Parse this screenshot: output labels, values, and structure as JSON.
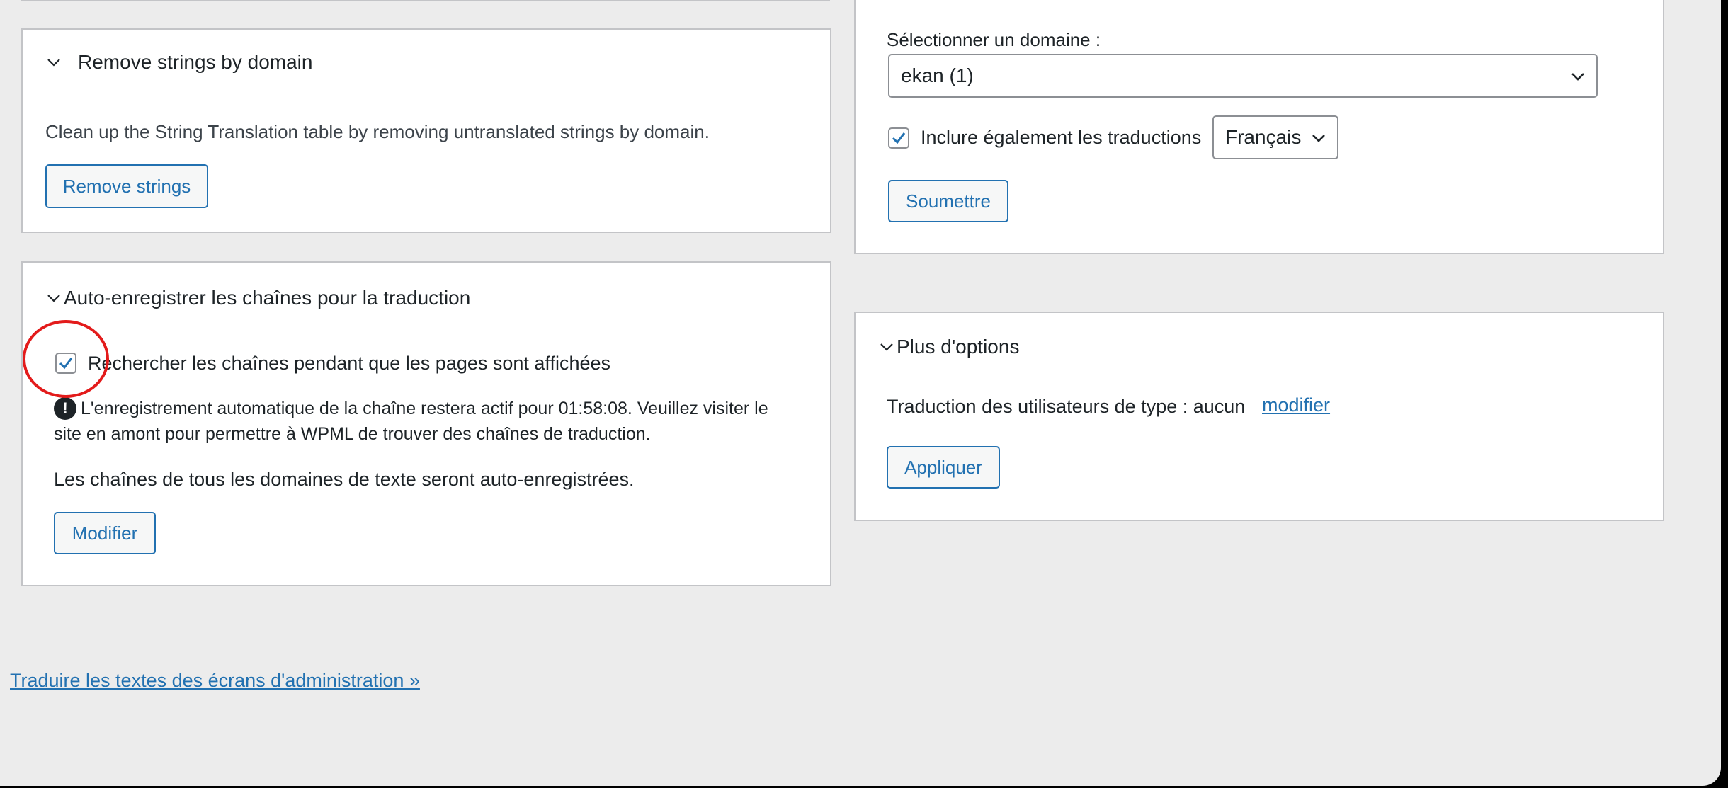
{
  "left_top_box": {
    "title": "Remove strings by domain",
    "description": "Clean up the String Translation table by removing untranslated strings by domain.",
    "button_label": "Remove strings"
  },
  "right_top_box": {
    "select_label": "Sélectionner un domaine :",
    "select_value": "ekan (1)",
    "include_translations_label": "Inclure également les traductions",
    "include_translations_checked": true,
    "language_value": "Français",
    "submit_label": "Soumettre"
  },
  "auto_register_box": {
    "title": "Auto-enregistrer les chaînes pour la traduction",
    "checkbox_label": "Rechercher les chaînes pendant que les pages sont affichées",
    "checkbox_checked": true,
    "notice_line1": "L'enregistrement automatique de la chaîne restera actif pour 01:58:08. Veuillez visiter le",
    "notice_line2": "site en amont pour permettre à WPML de trouver des chaînes de traduction.",
    "domains_text": "Les chaînes de tous les domaines de texte seront auto-enregistrées.",
    "button_label": "Modifier"
  },
  "more_options_box": {
    "title": "Plus d'options",
    "user_translation_text": "Traduction des utilisateurs de type : aucun",
    "modify_link": "modifier",
    "apply_label": "Appliquer"
  },
  "footer_link": "Traduire les textes des écrans d'administration »",
  "colors": {
    "accent": "#2271b1",
    "annotation_circle": "#e31b1b",
    "background": "#ececec"
  },
  "icons": [
    "chevron-down-icon",
    "checkmark-icon",
    "exclamation-icon"
  ]
}
